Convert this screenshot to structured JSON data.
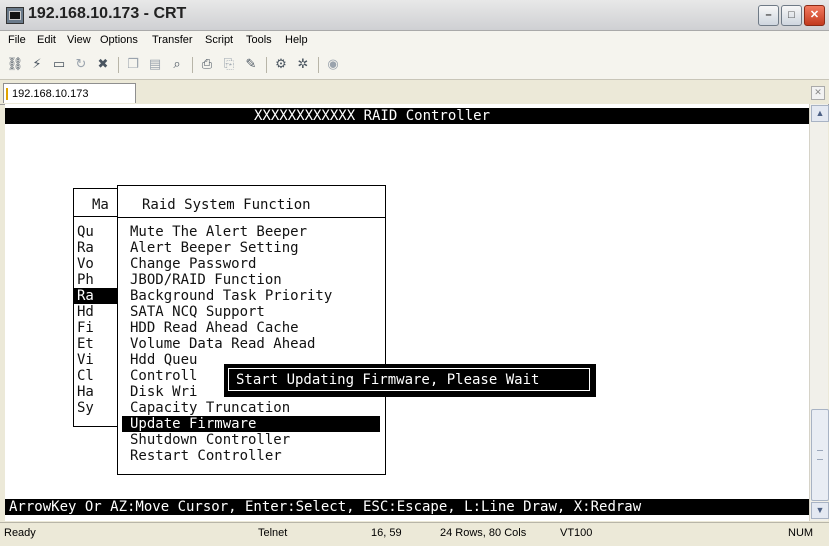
{
  "window": {
    "title": "192.168.10.173 - CRT",
    "buttons": {
      "minimize": "–",
      "maximize": "□",
      "close": "✕"
    }
  },
  "menubar": [
    "File",
    "Edit",
    "View",
    "Options",
    "Transfer",
    "Script",
    "Tools",
    "Help"
  ],
  "toolbar": {
    "icons": [
      "connect-icon",
      "quick-connect-icon",
      "connect-tab-icon",
      "reconnect-icon",
      "disconnect-icon",
      "copy-icon",
      "paste-icon",
      "find-icon",
      "print-icon",
      "print-setup-icon",
      "session-log-icon",
      "session-options-icon",
      "global-options-icon",
      "help-icon"
    ]
  },
  "tab": {
    "label": "192.168.10.173",
    "close": "✕"
  },
  "terminal": {
    "header": "XXXXXXXXXXXX RAID Controller",
    "main_menu_title_fragment": "Ma",
    "main_menu_items": [
      "Qu",
      "Ra",
      "Vo",
      "Ph",
      "Ra",
      "Hd",
      "Fi",
      "Et",
      "Vi",
      "Cl",
      "Ha",
      "Sy"
    ],
    "main_menu_selected_index": 4,
    "submenu": {
      "title": "Raid System Function",
      "items": [
        "Mute The Alert Beeper",
        "Alert Beeper Setting",
        "Change Password",
        "JBOD/RAID Function",
        "Background Task Priority",
        "SATA NCQ Support",
        "HDD Read Ahead Cache",
        "Volume Data Read Ahead",
        "Hdd Queu",
        "Controll",
        "Disk Wri",
        "Capacity Truncation",
        "Update Firmware",
        "Shutdown Controller",
        "Restart Controller"
      ],
      "selected_index": 12
    },
    "popup_message": "Start Updating Firmware, Please Wait",
    "footer": "ArrowKey Or AZ:Move Cursor, Enter:Select, ESC:Escape, L:Line Draw, X:Redraw"
  },
  "statusbar": {
    "state": "Ready",
    "protocol": "Telnet",
    "cursor": "16, 59",
    "size": "24 Rows, 80 Cols",
    "emulation": "VT100",
    "num": "NUM"
  }
}
